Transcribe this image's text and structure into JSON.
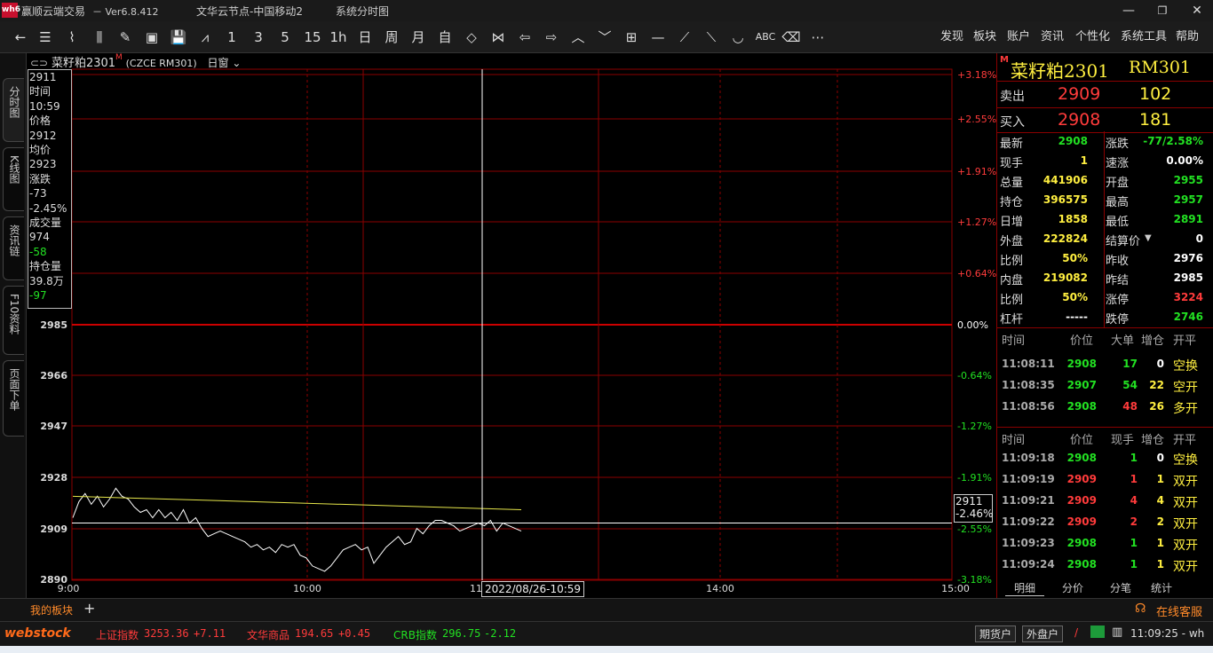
{
  "titlebar": {
    "logo": "wh6",
    "app": "赢顺云端交易",
    "version": "－ Ver6.8.412",
    "server": "文华云节点-中国移动2",
    "view": "系统分时图",
    "min": "—",
    "max": "❐",
    "close": "✕"
  },
  "toolbar": {
    "periods": [
      "1",
      "3",
      "5",
      "15",
      "1h",
      "日",
      "周",
      "月",
      "自"
    ],
    "menus": [
      "发现",
      "板块",
      "账户",
      "资讯",
      "个性化",
      "系统工具",
      "帮助"
    ],
    "abc": "ABC"
  },
  "lefttabs": [
    "分时图",
    "K线图",
    "资讯链",
    "F10资料",
    "页面下单"
  ],
  "chart": {
    "symbol": "菜籽粕2301",
    "exchange": "(CZCE RM301)",
    "period": "日窗",
    "mark": "M",
    "price_ticks": [
      "2985",
      "2966",
      "2947",
      "2928",
      "2909",
      "2890"
    ],
    "pct_up": [
      "+3.18%",
      "+2.55%",
      "+1.91%",
      "+1.27%",
      "+0.64%",
      "0.00%"
    ],
    "pct_dn": [
      "-0.64%",
      "-1.27%",
      "-1.91%",
      "-2.55%",
      "-3.18%"
    ],
    "time_ticks": [
      "9:00",
      "10:00",
      "11",
      "14:00",
      "15:00"
    ],
    "cursor_price": "2911",
    "cursor_pct": "-2.46%",
    "cursor_time": "2022/08/26-10:59",
    "info": {
      "price_top": "2911",
      "time_lbl": "时间",
      "time": "10:59",
      "price_lbl": "价格",
      "price": "2912",
      "avg_lbl": "均价",
      "avg": "2923",
      "chg_lbl": "涨跌",
      "chg": "-73",
      "chg_pct": "-2.45%",
      "vol_lbl": "成交量",
      "vol": "974",
      "vol_chg": "-58",
      "oi_lbl": "持仓量",
      "oi": "39.8万",
      "oi_chg": "-97"
    }
  },
  "quote": {
    "mark": "M",
    "name": "菜籽粕2301",
    "code": "RM301",
    "ask_lbl": "卖出",
    "ask": "2909",
    "ask_vol": "102",
    "bid_lbl": "买入",
    "bid": "2908",
    "bid_vol": "181",
    "left": [
      [
        "最新",
        "2908"
      ],
      [
        "现手",
        "1"
      ],
      [
        "总量",
        "441906"
      ],
      [
        "持仓",
        "396575"
      ],
      [
        "日增",
        "1858"
      ],
      [
        "外盘",
        "222824"
      ],
      [
        "比例",
        "50%"
      ],
      [
        "内盘",
        "219082"
      ],
      [
        "比例",
        "50%"
      ],
      [
        "杠杆",
        "-----"
      ]
    ],
    "right": [
      [
        "涨跌",
        "-77/2.58%"
      ],
      [
        "速涨",
        "0.00%"
      ],
      [
        "开盘",
        "2955"
      ],
      [
        "最高",
        "2957"
      ],
      [
        "最低",
        "2891"
      ],
      [
        "结算价",
        "0"
      ],
      [
        "昨收",
        "2976"
      ],
      [
        "昨结",
        "2985"
      ],
      [
        "涨停",
        "3224"
      ],
      [
        "跌停",
        "2746"
      ]
    ]
  },
  "bigorders": {
    "headers": [
      "时间",
      "价位",
      "大单",
      "增仓",
      "开平"
    ],
    "rows": [
      [
        "11:08:11",
        "2908",
        "17",
        "0",
        "空换"
      ],
      [
        "11:08:35",
        "2907",
        "54",
        "22",
        "空开"
      ],
      [
        "11:08:56",
        "2908",
        "48",
        "26",
        "多开"
      ]
    ]
  },
  "ticks": {
    "headers": [
      "时间",
      "价位",
      "现手",
      "增仓",
      "开平"
    ],
    "rows": [
      [
        "11:09:18",
        "2908",
        "1",
        "0",
        "空换"
      ],
      [
        "11:09:19",
        "2909",
        "1",
        "1",
        "双开"
      ],
      [
        "11:09:21",
        "2909",
        "4",
        "4",
        "双开"
      ],
      [
        "11:09:22",
        "2909",
        "2",
        "2",
        "双开"
      ],
      [
        "11:09:23",
        "2908",
        "1",
        "1",
        "双开"
      ],
      [
        "11:09:24",
        "2908",
        "1",
        "1",
        "双开"
      ]
    ]
  },
  "bottomtabs": [
    "明细",
    "分价",
    "分笔",
    "统计"
  ],
  "blockbar": {
    "tab": "我的板块",
    "add": "+",
    "service": "在线客服"
  },
  "statusbar": {
    "brand": "webstock",
    "idx": [
      {
        "name": "上证指数",
        "val": "3253.36",
        "chg": "+7.11"
      },
      {
        "name": "文华商品",
        "val": "194.65",
        "chg": "+0.45"
      },
      {
        "name": "CRB指数",
        "val": "296.75",
        "chg": "-2.12"
      }
    ],
    "futures": "期货户",
    "options": "外盘户",
    "clock": "11:09:25 - wh"
  },
  "series": {
    "price": [
      2913,
      2919,
      2922,
      2918,
      2921,
      2917,
      2920,
      2924,
      2921,
      2920,
      2917,
      2915,
      2916,
      2913,
      2916,
      2913,
      2915,
      2912,
      2916,
      2911,
      2913,
      2909,
      2906,
      2907,
      2908,
      2907,
      2906,
      2905,
      2904,
      2902,
      2903,
      2901,
      2902,
      2900,
      2903,
      2902,
      2903,
      2899,
      2898,
      2895,
      2894,
      2893,
      2895,
      2898,
      2901,
      2902,
      2903,
      2901,
      2902,
      2896,
      2899,
      2902,
      2904,
      2906,
      2903,
      2904,
      2909,
      2907,
      2910,
      2912,
      2912,
      2911,
      2910,
      2908,
      2909,
      2910,
      2911,
      2910,
      2912,
      2908,
      2911,
      2910,
      2909,
      2908
    ],
    "avg_start": 2921,
    "avg_end": 2916
  }
}
